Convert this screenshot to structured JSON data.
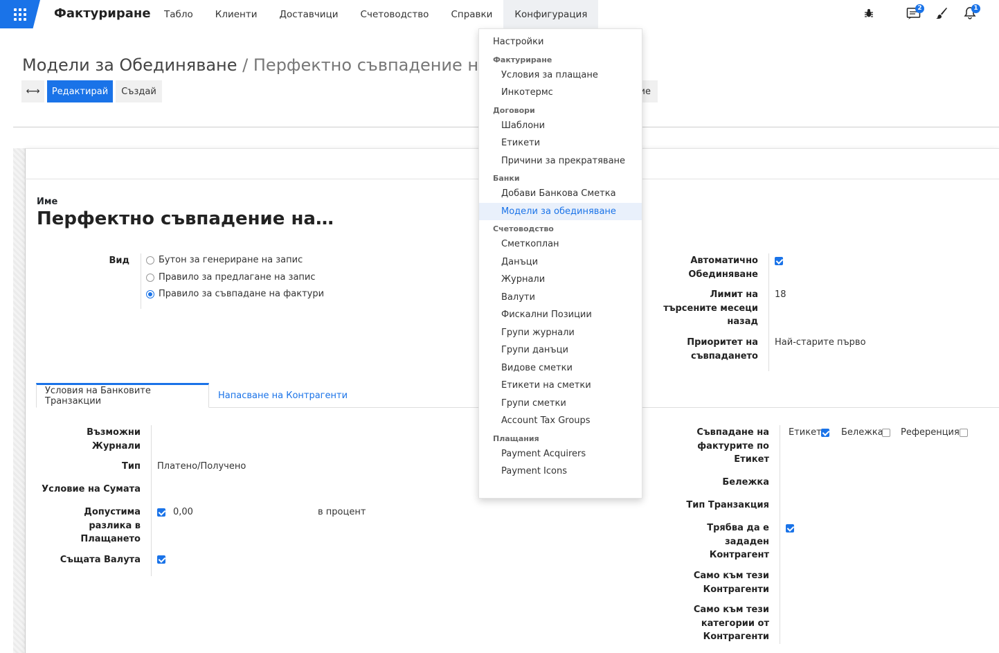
{
  "navbar": {
    "brand": "Фактуриране",
    "menu": [
      "Табло",
      "Клиенти",
      "Доставчици",
      "Счетоводство",
      "Справки",
      "Конфигурация"
    ],
    "open_menu_index": 5,
    "badges": {
      "messages": "2",
      "activities": "1"
    }
  },
  "control_panel": {
    "breadcrumb_parent": "Модели за Обединяване",
    "breadcrumb_sep": "/",
    "breadcrumb_current": "Перфектно съвпадение на Фактури",
    "edit_label": "Редактирай",
    "create_label": "Създай",
    "hidden_button_partial": "ие"
  },
  "form": {
    "name_label": "Име",
    "name_value": "Перфектно съвпадение на…",
    "type_label": "Вид",
    "type_options": [
      {
        "label": "Бутон за генериране на запис",
        "checked": false
      },
      {
        "label": "Правило за предлагане на запис",
        "checked": false
      },
      {
        "label": "Правило за съвпадане на фактури",
        "checked": true
      }
    ],
    "auto_reconcile_label": "Автоматично Обединяване",
    "auto_reconcile": true,
    "month_limit_label": "Лимит на търсените месеци назад",
    "month_limit_value": "18",
    "priority_label": "Приоритет на съвпадането",
    "priority_value": "Най-старите първо"
  },
  "tabs": [
    "Условия на Банковите Транзакции",
    "Напасване на Контрагенти"
  ],
  "bank_conditions": {
    "journals_label": "Възможни Журнали",
    "type_label": "Тип",
    "type_value": "Платено/Получено",
    "amount_label": "Условие на Сумата",
    "tolerance_label": "Допустима разлика в Плащането",
    "tolerance_checked": true,
    "tolerance_value": "0,00",
    "tolerance_unit": "в процент",
    "same_currency_label": "Същата Валута",
    "same_currency": true,
    "match_by_label": "Съвпадане на фактурите по Етикет",
    "match_label_opt": "Етикет",
    "match_label_checked": true,
    "match_note_opt": "Бележка",
    "match_note_checked": false,
    "match_ref_opt": "Референция",
    "match_ref_checked": false,
    "note_label": "Бележка",
    "transaction_type_label": "Тип Транзакция",
    "partner_required_label": "Трябва да е зададен Контрагент",
    "partner_required": true,
    "only_partners_label": "Само към тези Контрагенти",
    "only_categories_label": "Само към тези категории от Контрагенти"
  },
  "dropdown": {
    "items": [
      {
        "kind": "top",
        "label": "Настройки"
      },
      {
        "kind": "header",
        "label": "Фактуриране"
      },
      {
        "kind": "sub",
        "label": "Условия за плащане"
      },
      {
        "kind": "sub",
        "label": "Инкотермс"
      },
      {
        "kind": "header",
        "label": "Договори"
      },
      {
        "kind": "sub",
        "label": "Шаблони"
      },
      {
        "kind": "sub",
        "label": "Етикети"
      },
      {
        "kind": "sub",
        "label": "Причини за прекратяване"
      },
      {
        "kind": "header",
        "label": "Банки"
      },
      {
        "kind": "sub",
        "label": "Добави Банкова Сметка"
      },
      {
        "kind": "sub",
        "label": "Модели за обединяване",
        "active": true
      },
      {
        "kind": "header",
        "label": "Счетоводство"
      },
      {
        "kind": "sub",
        "label": "Сметкоплан"
      },
      {
        "kind": "sub",
        "label": "Данъци"
      },
      {
        "kind": "sub",
        "label": "Журнали"
      },
      {
        "kind": "sub",
        "label": "Валути"
      },
      {
        "kind": "sub",
        "label": "Фискални Позиции"
      },
      {
        "kind": "sub",
        "label": "Групи журнали"
      },
      {
        "kind": "sub",
        "label": "Групи данъци"
      },
      {
        "kind": "sub",
        "label": "Видове сметки"
      },
      {
        "kind": "sub",
        "label": "Етикети на сметки"
      },
      {
        "kind": "sub",
        "label": "Групи сметки"
      },
      {
        "kind": "sub",
        "label": "Account Tax Groups"
      },
      {
        "kind": "header",
        "label": "Плащания"
      },
      {
        "kind": "sub",
        "label": "Payment Acquirers"
      },
      {
        "kind": "sub",
        "label": "Payment Icons"
      }
    ]
  },
  "colors": {
    "accent": "#1a73e8"
  },
  "icons": [
    "apps-grid-icon",
    "bug-icon",
    "chat-icon",
    "brush-icon",
    "bell-icon",
    "expand-icon"
  ]
}
